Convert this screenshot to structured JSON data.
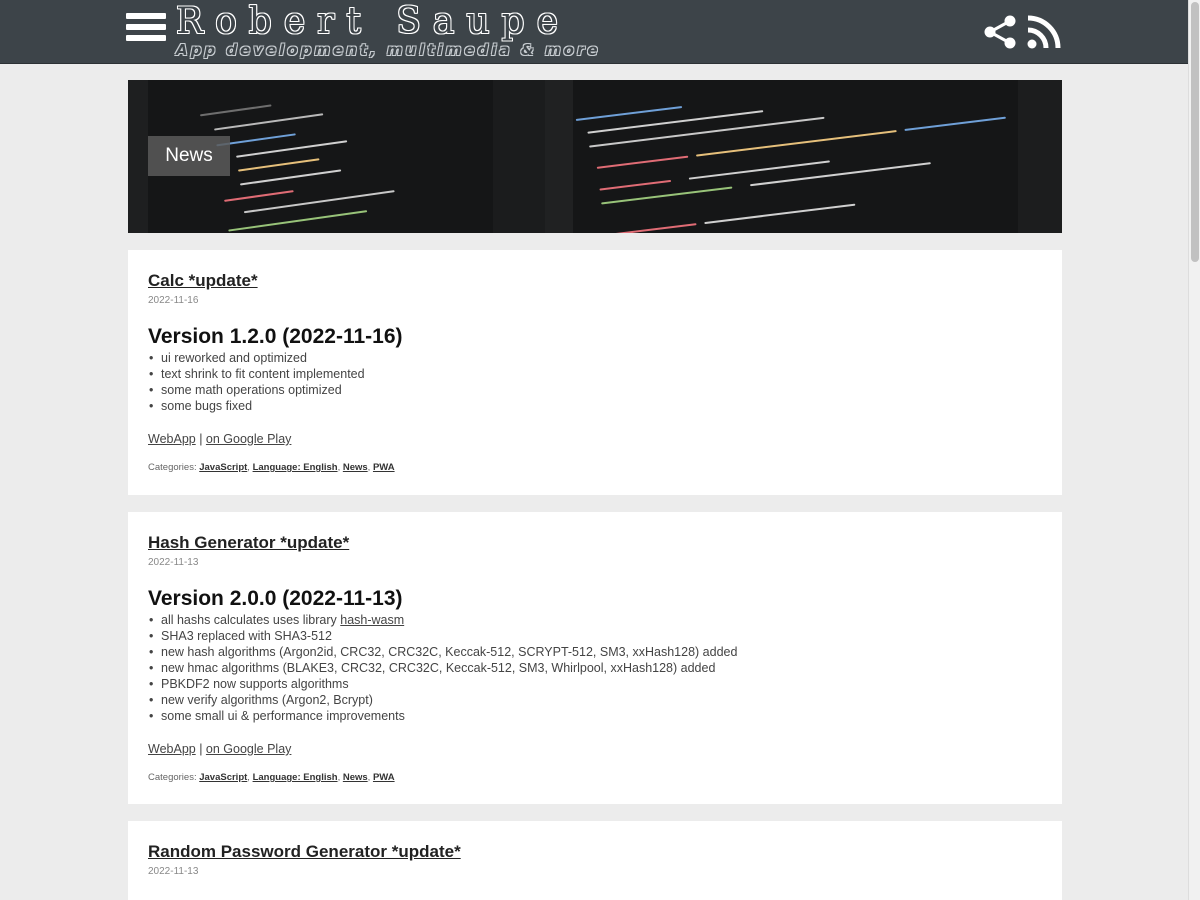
{
  "header": {
    "site_name": "Robert Saupe",
    "tagline": "App development, multimedia & more",
    "menu_icon": "hamburger-menu-icon",
    "share_icon": "share-icon",
    "rss_icon": "rss-feed-icon",
    "bar_color": "#3d4449"
  },
  "hero": {
    "label": "News"
  },
  "posts": [
    {
      "title": "Calc *update*",
      "date": "2022-11-16",
      "version_heading": "Version 1.2.0 (2022-11-16)",
      "changes": [
        "ui reworked and optimized",
        "text shrink to fit content implemented",
        "some math operations optimized",
        "some bugs fixed"
      ],
      "webapp_link": "WebApp",
      "separator": " | ",
      "play_link": "on Google Play",
      "categories_label": "Categories:",
      "categories": [
        "JavaScript",
        "Language: English",
        "News",
        "PWA"
      ]
    },
    {
      "title": "Hash Generator *update*",
      "date": "2022-11-13",
      "version_heading": "Version 2.0.0 (2022-11-13)",
      "changes_first_prefix": "all hashs calculates uses library ",
      "changes_first_link": "hash-wasm",
      "changes": [
        "SHA3 replaced with SHA3-512",
        "new hash algorithms (Argon2id, CRC32, CRC32C, Keccak-512, SCRYPT-512, SM3, xxHash128) added",
        "new hmac algorithms (BLAKE3, CRC32, CRC32C, Keccak-512, SM3, Whirlpool, xxHash128) added",
        "PBKDF2 now supports algorithms",
        "new verify algorithms (Argon2, Bcrypt)",
        "some small ui & performance improvements"
      ],
      "webapp_link": "WebApp",
      "separator": " | ",
      "play_link": "on Google Play",
      "categories_label": "Categories:",
      "categories": [
        "JavaScript",
        "Language: English",
        "News",
        "PWA"
      ]
    },
    {
      "title": "Random Password Generator *update*",
      "date": "2022-11-13"
    }
  ]
}
